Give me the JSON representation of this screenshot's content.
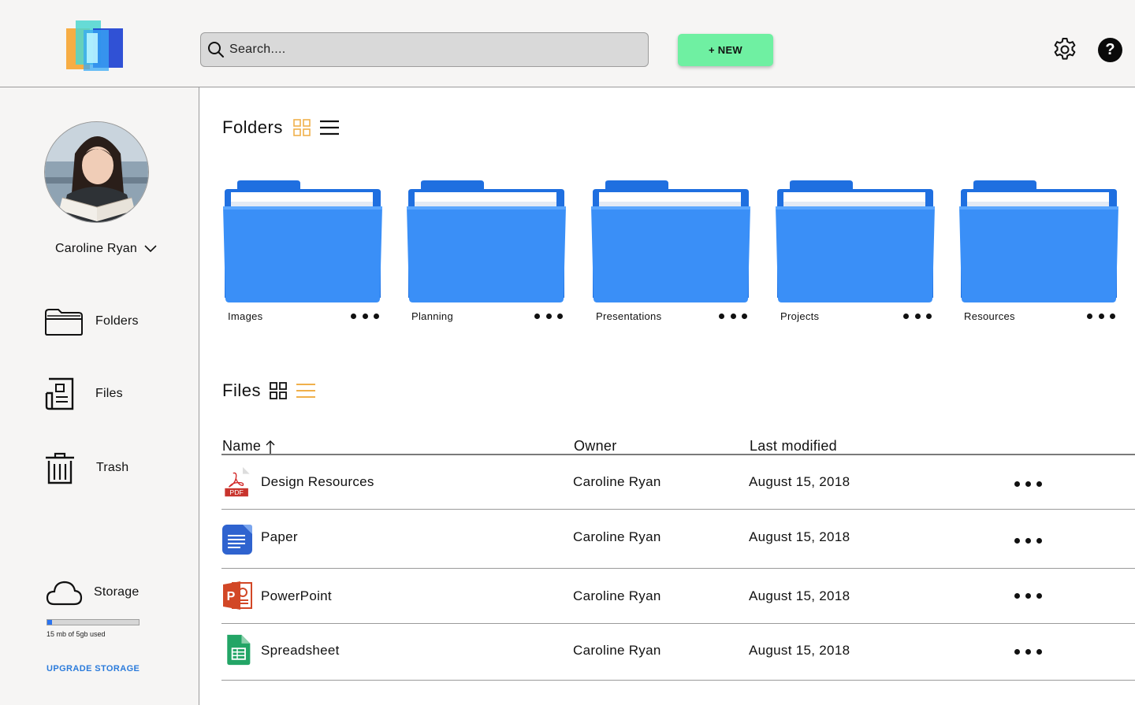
{
  "header": {
    "search_placeholder": "Search....",
    "new_button_label": "+ NEW",
    "help_label": "?"
  },
  "sidebar": {
    "user_name": "Caroline Ryan",
    "nav": [
      {
        "label": "Folders",
        "icon": "folder-icon"
      },
      {
        "label": "Files",
        "icon": "file-icon"
      },
      {
        "label": "Trash",
        "icon": "trash-icon"
      }
    ],
    "storage": {
      "label": "Storage",
      "usage_text": "15 mb of 5gb used",
      "used_fraction": 0.05,
      "upgrade_label": "UPGRADE STORAGE"
    }
  },
  "folders_section": {
    "title": "Folders",
    "active_view": "grid",
    "folders": [
      {
        "name": "Images"
      },
      {
        "name": "Planning"
      },
      {
        "name": "Presentations"
      },
      {
        "name": "Projects"
      },
      {
        "name": "Resources"
      }
    ]
  },
  "files_section": {
    "title": "Files",
    "active_view": "list",
    "columns": {
      "name": "Name",
      "owner": "Owner",
      "modified": "Last modified"
    },
    "sort_indicator": "arrow-up",
    "files": [
      {
        "name": "Design Resources",
        "type": "pdf",
        "owner": "Caroline Ryan",
        "modified": "August 15, 2018"
      },
      {
        "name": "Paper",
        "type": "doc",
        "owner": "Caroline Ryan",
        "modified": "August 15, 2018"
      },
      {
        "name": "PowerPoint",
        "type": "ppt",
        "owner": "Caroline Ryan",
        "modified": "August 15, 2018"
      },
      {
        "name": "Spreadsheet",
        "type": "sheet",
        "owner": "Caroline Ryan",
        "modified": "August 15, 2018"
      }
    ]
  },
  "colors": {
    "new_button": "#6ff0a2",
    "folder_blue": "#3a8ff7",
    "active_view_icon": "#f0b04b",
    "upgrade_link": "#2b7bdb",
    "storage_fill": "#2b74f0"
  }
}
